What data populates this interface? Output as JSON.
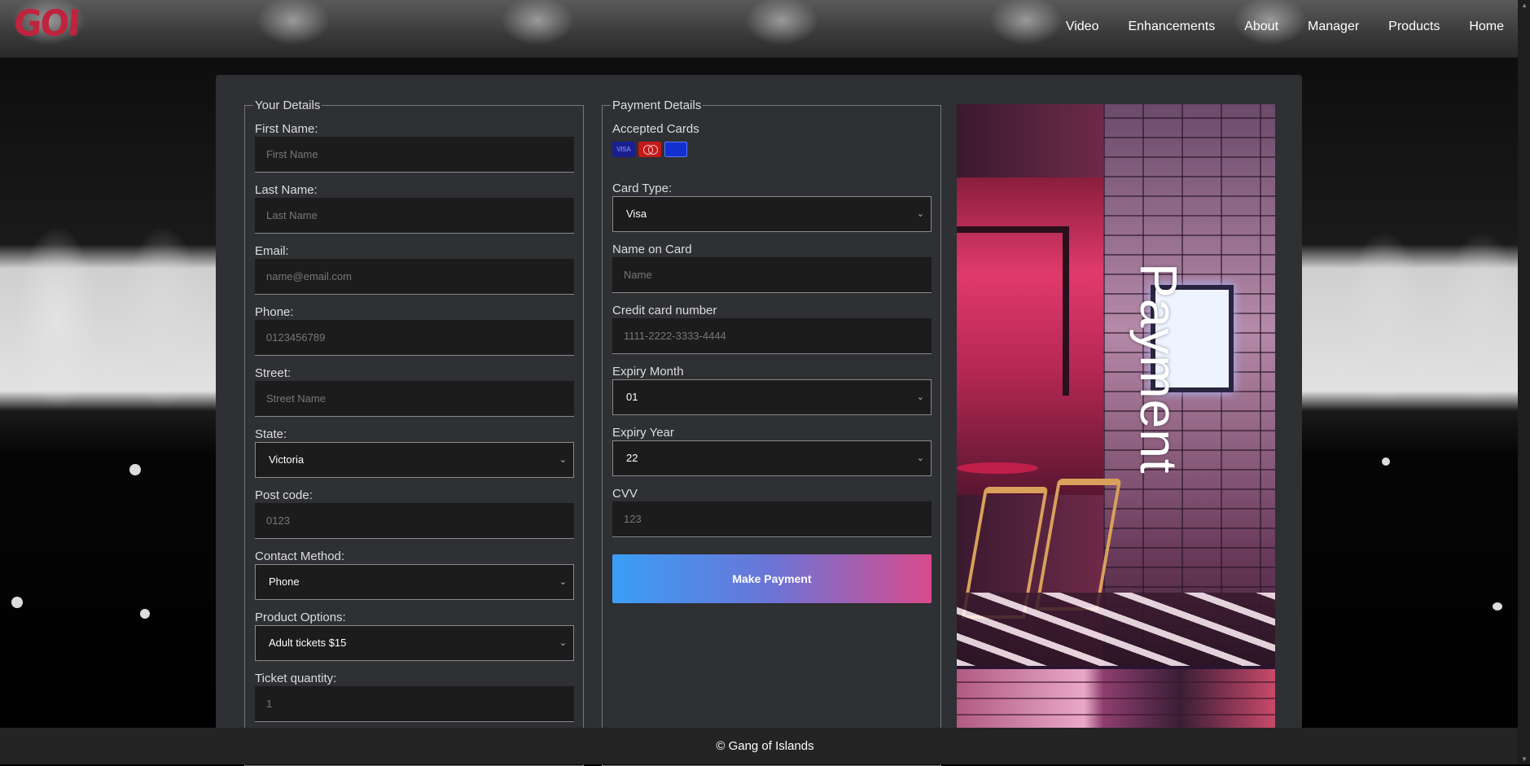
{
  "brand": {
    "logo_text": "GOI"
  },
  "nav": {
    "items": [
      "Video",
      "Enhancements",
      "About",
      "Manager",
      "Products",
      "Home"
    ]
  },
  "details": {
    "legend": "Your Details",
    "first_name": {
      "label": "First Name:",
      "placeholder": "First Name"
    },
    "last_name": {
      "label": "Last Name:",
      "placeholder": "Last Name"
    },
    "email": {
      "label": "Email:",
      "placeholder": "name@email.com"
    },
    "phone": {
      "label": "Phone:",
      "placeholder": "0123456789"
    },
    "street": {
      "label": "Street:",
      "placeholder": "Street Name"
    },
    "state": {
      "label": "State:",
      "value": "Victoria"
    },
    "postcode": {
      "label": "Post code:",
      "placeholder": "0123"
    },
    "contact_method": {
      "label": "Contact Method:",
      "value": "Phone"
    },
    "product_options": {
      "label": "Product Options:",
      "value": "Adult tickets $15"
    },
    "ticket_quantity": {
      "label": "Ticket quantity:",
      "placeholder": "1"
    }
  },
  "payment": {
    "legend": "Payment Details",
    "accepted_cards_label": "Accepted Cards",
    "cards": [
      {
        "icon": "visa-card-icon",
        "text": "VISA"
      },
      {
        "icon": "mastercard-icon",
        "text": ""
      },
      {
        "icon": "amex-card-icon",
        "text": ""
      }
    ],
    "card_type": {
      "label": "Card Type:",
      "value": "Visa"
    },
    "name_on_card": {
      "label": "Name on Card",
      "placeholder": "Name"
    },
    "card_number": {
      "label": "Credit card number",
      "placeholder": "1111-2222-3333-4444"
    },
    "expiry_month": {
      "label": "Expiry Month",
      "value": "01"
    },
    "expiry_year": {
      "label": "Expiry Year",
      "value": "22"
    },
    "cvv": {
      "label": "CVV",
      "placeholder": "123"
    },
    "submit_label": "Make Payment"
  },
  "hero": {
    "vertical_title": "Payment"
  },
  "footer": {
    "text": "© Gang of Islands"
  },
  "colors": {
    "accent_gradient_start": "#3a9ef5",
    "accent_gradient_end": "#d94a8c",
    "logo": "#c0233d",
    "panel": "#2e3033"
  }
}
